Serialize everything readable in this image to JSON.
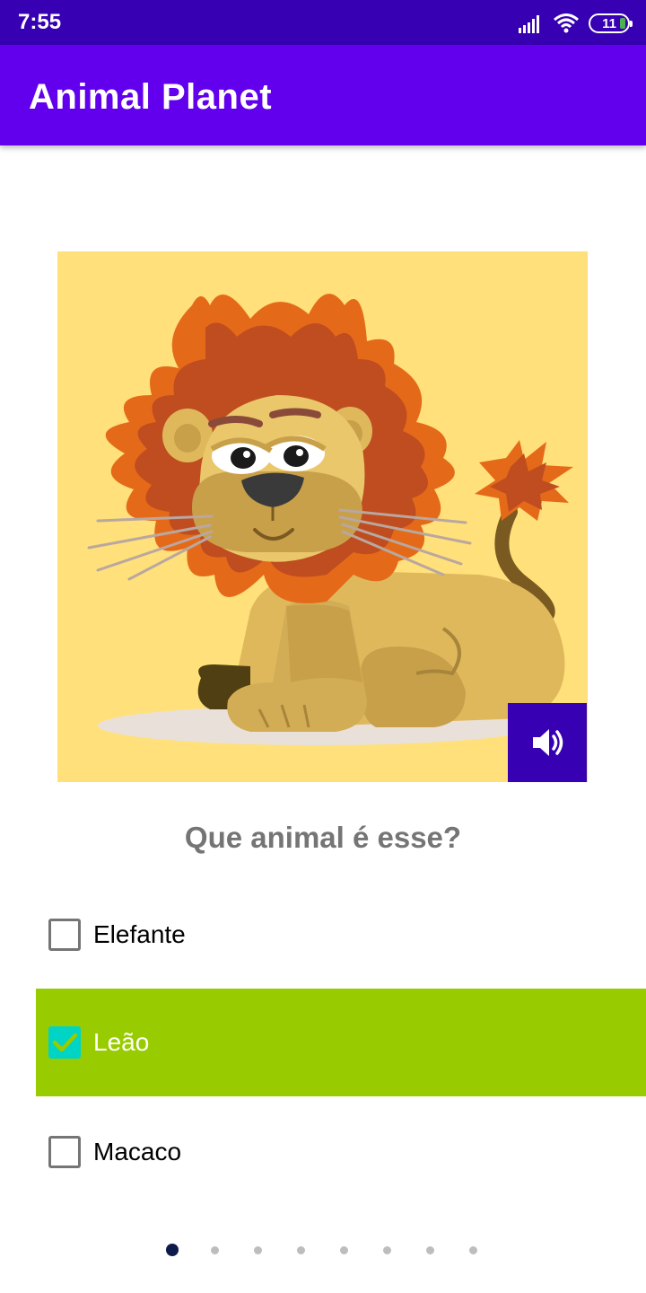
{
  "status_bar": {
    "time": "7:55",
    "battery_level": "11",
    "icons": [
      "signal-icon",
      "wifi-icon",
      "battery-icon"
    ]
  },
  "app_bar": {
    "title": "Animal Planet",
    "color": "#6200ee"
  },
  "quiz": {
    "image": "lion-illustration",
    "sound_button_icon": "volume-icon",
    "question": "Que animal é esse?",
    "options": [
      {
        "label": "Elefante",
        "checked": false
      },
      {
        "label": "Leão",
        "checked": true
      },
      {
        "label": "Macaco",
        "checked": false
      }
    ],
    "selected_color": "#99cc00",
    "check_color": "#00d4c4"
  },
  "pager": {
    "total": 8,
    "current": 1
  }
}
